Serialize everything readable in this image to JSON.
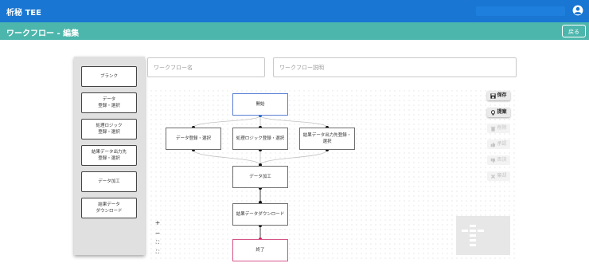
{
  "app": {
    "title": "析秘 TEE"
  },
  "subheader": {
    "title": "ワークフロー - 編集",
    "back_label": "戻る"
  },
  "form": {
    "name_placeholder": "ワークフロー名",
    "description_placeholder": "ワークフロー説明"
  },
  "palette": {
    "items": [
      {
        "label": "ブランク"
      },
      {
        "label": "データ\n登録・選択"
      },
      {
        "label": "処理ロジック\n登録・選択"
      },
      {
        "label": "結果データ出力先\n登録・選択"
      },
      {
        "label": "データ加工"
      },
      {
        "label": "結果データ\nダウンロード"
      }
    ]
  },
  "flow": {
    "nodes": {
      "start": "開始",
      "data_select": "データ登録・選択",
      "logic_select": "処理ロジック登録・選択",
      "output_select": "結果データ出力先登録・選択",
      "process": "データ加工",
      "download": "結果データダウンロード",
      "end": "終了"
    },
    "zoom": {
      "in": "+",
      "out": "−",
      "fit": "⛶",
      "lock": "⛶"
    }
  },
  "toolbar": {
    "save": "保存",
    "suggest": "提案",
    "delete": "削除",
    "approve": "承認",
    "reject": "否決",
    "reset": "棄却"
  },
  "colors": {
    "header": "#1976d2",
    "subheader": "#4db6ac",
    "start_border": "#5b7fd6",
    "end_border": "#d6568a"
  }
}
